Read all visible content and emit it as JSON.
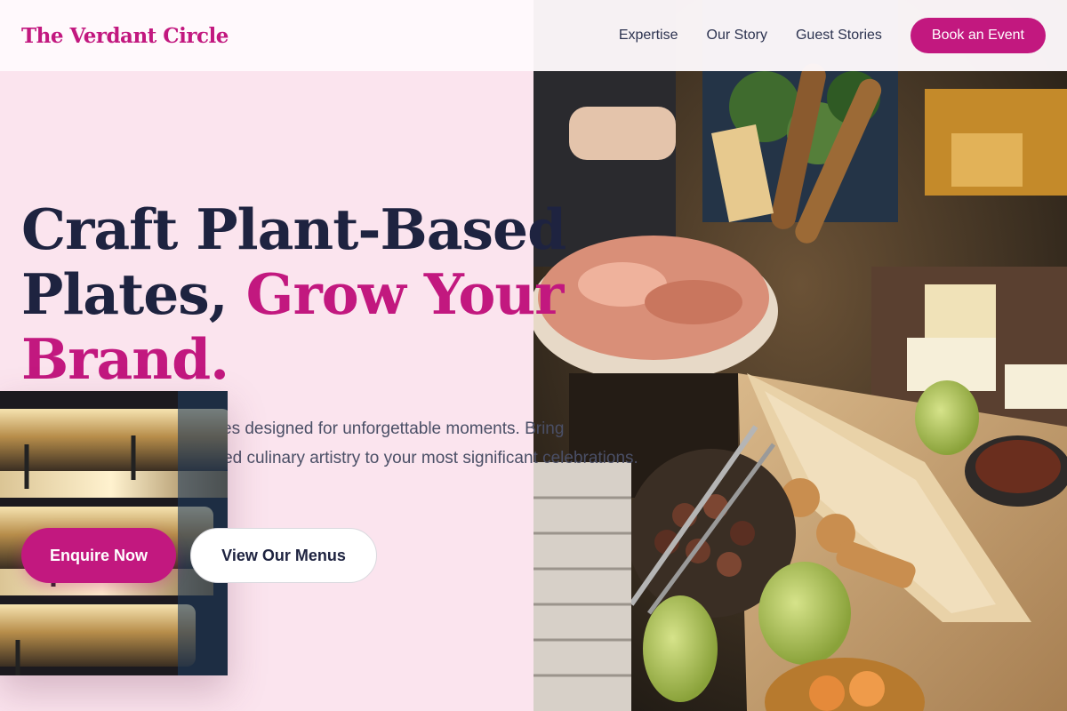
{
  "header": {
    "logo": "The Verdant Circle",
    "nav": [
      {
        "label": "Expertise"
      },
      {
        "label": "Our Story"
      },
      {
        "label": "Guest Stories"
      }
    ],
    "cta_label": "Book an Event"
  },
  "hero": {
    "headline_line1": "Craft Plant-Based",
    "headline_line2_plain": "Plates, ",
    "headline_line2_accent": "Grow Your",
    "headline_line3_accent": "Brand.",
    "subtext": "Exceptional catering services designed for unforgettable moments. Bring sophisticated, nature-inspired culinary artistry to your most significant celebrations.",
    "primary_button": "Enquire Now",
    "secondary_button": "View Our Menus"
  },
  "colors": {
    "accent": "#c2187f",
    "background": "#fbe4ee",
    "heading": "#1e2340"
  }
}
